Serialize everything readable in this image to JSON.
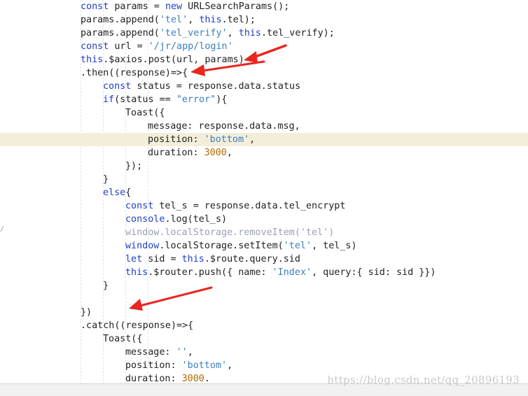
{
  "code_lines": [
    {
      "indent": 0,
      "tokens": [
        {
          "t": "const",
          "c": "kw"
        },
        {
          "t": " params = "
        },
        {
          "t": "new",
          "c": "kw"
        },
        {
          "t": " URLSearchParams();"
        }
      ]
    },
    {
      "indent": 0,
      "tokens": [
        {
          "t": "params.append("
        },
        {
          "t": "'tel'",
          "c": "str"
        },
        {
          "t": ", "
        },
        {
          "t": "this",
          "c": "kw"
        },
        {
          "t": ".tel);"
        }
      ]
    },
    {
      "indent": 0,
      "tokens": [
        {
          "t": "params.append("
        },
        {
          "t": "'tel_verify'",
          "c": "str"
        },
        {
          "t": ", "
        },
        {
          "t": "this",
          "c": "kw"
        },
        {
          "t": ".tel_verify);"
        }
      ]
    },
    {
      "indent": 0,
      "tokens": [
        {
          "t": "const",
          "c": "kw"
        },
        {
          "t": " url = "
        },
        {
          "t": "'/jr/app/login'",
          "c": "str"
        }
      ]
    },
    {
      "indent": 0,
      "tokens": [
        {
          "t": "this",
          "c": "kw"
        },
        {
          "t": ".$axios.post(url, params)"
        }
      ]
    },
    {
      "indent": 0,
      "tokens": [
        {
          "t": ".then((response)=>{"
        }
      ]
    },
    {
      "indent": 1,
      "tokens": [
        {
          "t": "const",
          "c": "kw"
        },
        {
          "t": " status = response.data.status"
        }
      ]
    },
    {
      "indent": 1,
      "tokens": [
        {
          "t": "if",
          "c": "kw"
        },
        {
          "t": "(status == "
        },
        {
          "t": "\"error\"",
          "c": "str"
        },
        {
          "t": "){"
        }
      ]
    },
    {
      "indent": 2,
      "tokens": [
        {
          "t": "Toast({"
        }
      ]
    },
    {
      "indent": 3,
      "tokens": [
        {
          "t": "message: response.data.msg,"
        }
      ]
    },
    {
      "indent": 3,
      "highlight": true,
      "tokens": [
        {
          "t": "position: "
        },
        {
          "t": "'bottom'",
          "c": "str"
        },
        {
          "t": ","
        }
      ]
    },
    {
      "indent": 3,
      "tokens": [
        {
          "t": "duration: "
        },
        {
          "t": "3000",
          "c": "num"
        },
        {
          "t": ","
        }
      ]
    },
    {
      "indent": 2,
      "tokens": [
        {
          "t": "});"
        }
      ]
    },
    {
      "indent": 1,
      "tokens": [
        {
          "t": "}"
        }
      ]
    },
    {
      "indent": 1,
      "tokens": [
        {
          "t": "else",
          "c": "kw"
        },
        {
          "t": "{"
        }
      ]
    },
    {
      "indent": 2,
      "tokens": [
        {
          "t": "const",
          "c": "kw"
        },
        {
          "t": " tel_s = response.data.tel_encrypt"
        }
      ]
    },
    {
      "indent": 2,
      "tokens": [
        {
          "t": "console",
          "c": "kw"
        },
        {
          "t": ".log(tel_s)"
        }
      ]
    },
    {
      "indent": 2,
      "tokens": [
        {
          "t": "window.localStorage.removeItem('tel')",
          "c": "dim"
        }
      ]
    },
    {
      "indent": 2,
      "tokens": [
        {
          "t": "window",
          "c": "kw"
        },
        {
          "t": ".localStorage.setItem("
        },
        {
          "t": "'tel'",
          "c": "str"
        },
        {
          "t": ", tel_s)"
        }
      ]
    },
    {
      "indent": 2,
      "tokens": [
        {
          "t": "let",
          "c": "kw"
        },
        {
          "t": " sid = "
        },
        {
          "t": "this",
          "c": "kw"
        },
        {
          "t": ".$route.query.sid"
        }
      ]
    },
    {
      "indent": 2,
      "tokens": [
        {
          "t": "this",
          "c": "kw"
        },
        {
          "t": ".$router.push({ name: "
        },
        {
          "t": "'Index'",
          "c": "str"
        },
        {
          "t": ", query:{ sid: sid }})"
        }
      ]
    },
    {
      "indent": 1,
      "tokens": [
        {
          "t": "}"
        }
      ]
    },
    {
      "indent": 0,
      "tokens": []
    },
    {
      "indent": 0,
      "tokens": [
        {
          "t": "})"
        }
      ]
    },
    {
      "indent": 0,
      "tokens": [
        {
          "t": ".catch((response)=>{"
        }
      ]
    },
    {
      "indent": 1,
      "tokens": [
        {
          "t": "Toast({"
        }
      ]
    },
    {
      "indent": 2,
      "tokens": [
        {
          "t": "message: "
        },
        {
          "t": "''",
          "c": "str"
        },
        {
          "t": ","
        }
      ]
    },
    {
      "indent": 2,
      "tokens": [
        {
          "t": "position: "
        },
        {
          "t": "'bottom'",
          "c": "str"
        },
        {
          "t": ","
        }
      ]
    },
    {
      "indent": 2,
      "tokens": [
        {
          "t": "duration: "
        },
        {
          "t": "3000",
          "c": "num"
        },
        {
          "t": "."
        }
      ]
    }
  ],
  "watermark": "https://blog.csdn.net/qq_20896193",
  "gutter_mark": "/",
  "colors": {
    "keyword": "#1f3fc7",
    "string": "#3a7fbf",
    "number": "#b36b00",
    "highlight_line": "#f3eed9",
    "annotation_arrow": "#e8261f"
  },
  "annotations": [
    "red-arrow",
    "red-arrow",
    "red-arrow"
  ]
}
